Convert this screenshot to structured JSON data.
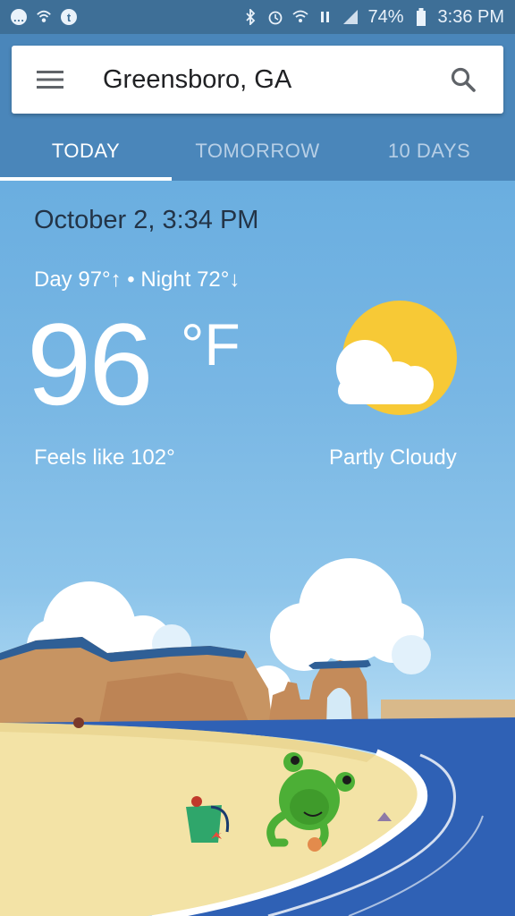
{
  "status_bar": {
    "battery": "74%",
    "time": "3:36 PM",
    "left_icons": [
      "chat-icon",
      "wifi-call-icon",
      "tumblr-icon"
    ],
    "right_icons": [
      "bluetooth-icon",
      "alarm-icon",
      "wifi-icon",
      "lte-icon",
      "signal-icon",
      "battery-icon"
    ]
  },
  "search": {
    "location": "Greensboro, GA"
  },
  "tabs": [
    {
      "label": "TODAY",
      "active": true
    },
    {
      "label": "TOMORROW",
      "active": false
    },
    {
      "label": "10 DAYS",
      "active": false
    }
  ],
  "weather": {
    "datetime": "October 2, 3:34 PM",
    "day_night": "Day 97°↑ • Night 72°↓",
    "temperature": "96",
    "unit": "°F",
    "feels_like": "Feels like 102°",
    "condition": "Partly Cloudy",
    "icon": "partly-cloudy-icon"
  },
  "colors": {
    "status_bar": "#3e6f97",
    "app_bar": "#4a86ba",
    "sky": "#6aaee0",
    "sun": "#f7c936",
    "sea": "#2f61b5",
    "sand": "#f3e3a6"
  }
}
